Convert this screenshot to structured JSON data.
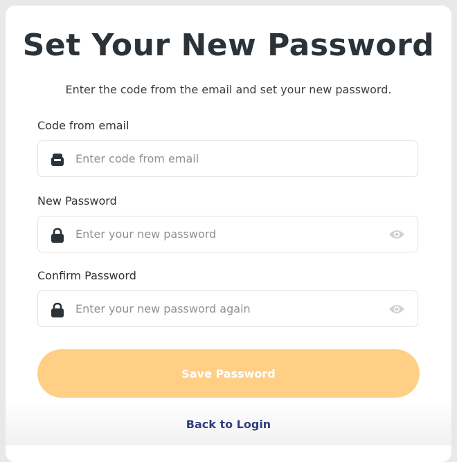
{
  "form": {
    "title": "Set Your New Password",
    "subtitle": "Enter the code from the email and set your new password.",
    "code_field": {
      "label": "Code from email",
      "placeholder": "Enter code from email",
      "value": "",
      "icon": "mailbox-icon"
    },
    "new_password_field": {
      "label": "New Password",
      "placeholder": "Enter your new password",
      "value": "",
      "icon": "lock-icon",
      "toggle_icon": "eye-icon"
    },
    "confirm_password_field": {
      "label": "Confirm Password",
      "placeholder": "Enter your new password again",
      "value": "",
      "icon": "lock-icon",
      "toggle_icon": "eye-icon"
    },
    "save_button_label": "Save Password",
    "back_link_label": "Back to Login"
  },
  "colors": {
    "background": "#e9e9eb",
    "card": "#ffffff",
    "title_text": "#2b3339",
    "button_accent": "#ffcf86",
    "button_text": "#ffffff",
    "link_text": "#2f3f7e",
    "icon": "#2b3339",
    "eye_icon": "#cfd1d4"
  }
}
